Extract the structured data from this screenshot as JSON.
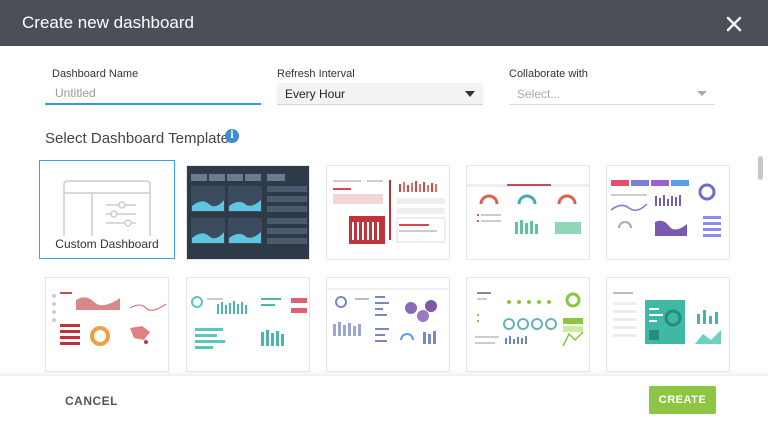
{
  "dialog": {
    "title": "Create new dashboard",
    "close_icon": "close-icon"
  },
  "form": {
    "name_label": "Dashboard Name",
    "name_placeholder": "Untitled",
    "refresh_label": "Refresh Interval",
    "refresh_value": "Every Hour",
    "collab_label": "Collaborate with",
    "collab_placeholder": "Select..."
  },
  "templates": {
    "section_title": "Select Dashboard Template",
    "info_icon": "info-icon",
    "custom_label": "Custom Dashboard",
    "items": [
      {
        "name": "template-custom",
        "selected": true
      },
      {
        "name": "template-dark-ops"
      },
      {
        "name": "template-red-metrics"
      },
      {
        "name": "template-gauges"
      },
      {
        "name": "template-purple-kpis"
      },
      {
        "name": "template-red-map"
      },
      {
        "name": "template-teal-bars"
      },
      {
        "name": "template-purple-bubbles"
      },
      {
        "name": "template-green-gauges"
      },
      {
        "name": "template-teal-tiles"
      }
    ]
  },
  "footer": {
    "cancel_label": "CANCEL",
    "create_label": "CREATE"
  },
  "colors": {
    "header": "#4a4f58",
    "accent_blue": "#2d9cdb",
    "create_green": "#8dc642"
  }
}
